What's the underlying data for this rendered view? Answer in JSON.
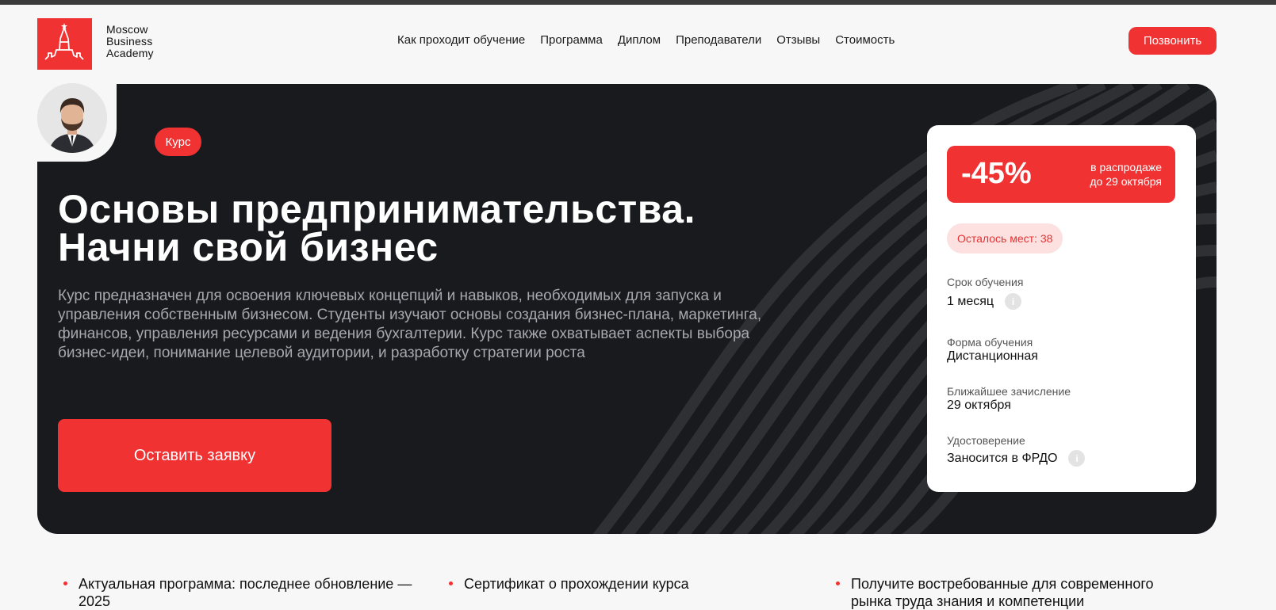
{
  "brand": {
    "line1": "Moscow",
    "line2": "Business",
    "line3": "Academy",
    "color": "#f03232"
  },
  "nav": {
    "items": [
      "Как проходит обучение",
      "Программа",
      "Диплом",
      "Преподаватели",
      "Отзывы",
      "Стоимость"
    ]
  },
  "header": {
    "call_label": "Позвонить"
  },
  "hero": {
    "badge": "Курс",
    "title_line1": "Основы предпринимательства.",
    "title_line2": "Начни свой бизнес",
    "description": "Курс предназначен для освоения ключевых концепций и навыков, необходимых для запуска и управления собственным бизнесом. Студенты изучают основы создания бизнес-плана, маркетинга, финансов, управления ресурсами и ведения бухгалтерии. Курс также охватывает аспекты выбора бизнес-идеи, понимание целевой аудитории, и разработку стратегии роста",
    "apply_label": "Оставить заявку"
  },
  "card": {
    "discount": "-45%",
    "sale_line1": "в распродаже",
    "sale_line2": "до 29 октября",
    "seats": "Осталось мест: 38",
    "info": [
      {
        "label": "Срок обучения",
        "value": "1 месяц",
        "info_icon": true
      },
      {
        "label": "Форма обучения",
        "value": "Дистанционная",
        "info_icon": false
      },
      {
        "label": "Ближайшее зачисление",
        "value": "29 октября",
        "info_icon": false
      },
      {
        "label": "Удостоверение",
        "value": "Заносится в ФРДО",
        "info_icon": true
      }
    ]
  },
  "features": [
    "Актуальная программа: последнее обновление — 2025",
    "Сертификат о прохождении курса",
    "Получите востребованные для современного рынка труда знания и компетенции"
  ]
}
